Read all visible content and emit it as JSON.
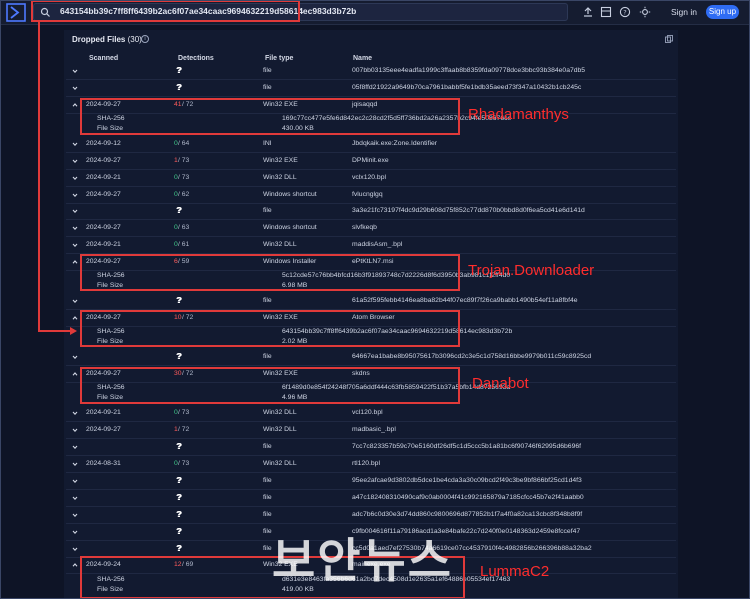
{
  "topbar": {
    "search_value": "643154bb39c7ff8ff6439b2ac6f07ae34caac9694632219d58614ec983d3b72b",
    "signin_label": "Sign in",
    "signup_label": "Sign up",
    "icons": [
      "upload-icon",
      "grid-icon",
      "chat-icon",
      "help-icon",
      "theme-icon"
    ]
  },
  "panel": {
    "title": "Dropped Files",
    "count": "(30)",
    "columns": {
      "scanned": "Scanned",
      "detections": "Detections",
      "file_type": "File type",
      "name": "Name"
    }
  },
  "rows": [
    {
      "scanned": "?",
      "det_num": "",
      "det_total": "?",
      "type": "file",
      "name": "007bb03135eee4eadfa1999c3ffaab8b8359fda09778dce3bbc93b384e0a7db5"
    },
    {
      "scanned": "?",
      "det_num": "",
      "det_total": "?",
      "type": "file",
      "name": "05f8ffd21922a9649b70ca7961babbf5fe1bdb35aeed73f347a10432b1cb245c"
    },
    {
      "scanned": "2024-09-27",
      "det_num": "41",
      "det_total": " / 72",
      "type": "Win32 EXE",
      "name": "jqisaqqd"
    },
    {
      "scanned": "2024-09-12",
      "det_num": "0",
      "det_total": " / 64",
      "type": "INI",
      "name": "Jbdqkaik.exe:Zone.Identifier"
    },
    {
      "scanned": "2024-09-27",
      "det_num": "1",
      "det_total": " / 73",
      "type": "Win32 EXE",
      "name": "DPMinit.exe"
    },
    {
      "scanned": "2024-09-21",
      "det_num": "0",
      "det_total": " / 73",
      "type": "Win32 DLL",
      "name": "vclx120.bpl"
    },
    {
      "scanned": "2024-09-27",
      "det_num": "0",
      "det_total": " / 62",
      "type": "Windows shortcut",
      "name": "fvlucnglgq"
    },
    {
      "scanned": "?",
      "det_num": "",
      "det_total": "?",
      "type": "file",
      "name": "3a3e21fc73197f4dc9d29b608d75f852c77dd870b0bbd8d0f6ea5cd41e6d141d"
    },
    {
      "scanned": "2024-09-27",
      "det_num": "0",
      "det_total": " / 63",
      "type": "Windows shortcut",
      "name": "slvfkeqb"
    },
    {
      "scanned": "2024-09-21",
      "det_num": "0",
      "det_total": " / 61",
      "type": "Win32 DLL",
      "name": "maddisAsm_.bpl"
    },
    {
      "scanned": "2024-09-27",
      "det_num": "6",
      "det_total": " / 59",
      "type": "Windows Installer",
      "name": "ePtKtLN7.msi"
    },
    {
      "scanned": "?",
      "det_num": "",
      "det_total": "?",
      "type": "file",
      "name": "61a52f595febb4146ea8ba82b44f07ec89f7f26ca9babb1490b54ef11a8fbf4e"
    },
    {
      "scanned": "2024-09-27",
      "det_num": "10",
      "det_total": " / 72",
      "type": "Win32 EXE",
      "name": "Atom Browser"
    },
    {
      "scanned": "?",
      "det_num": "",
      "det_total": "?",
      "type": "file",
      "name": "64667ea1babe8b95075617b3096cd2c3e5c1d758d16bbe9979b011c59c8925cd"
    },
    {
      "scanned": "2024-09-27",
      "det_num": "30",
      "det_total": " / 72",
      "type": "Win32 EXE",
      "name": "skdns"
    },
    {
      "scanned": "2024-09-21",
      "det_num": "0",
      "det_total": " / 73",
      "type": "Win32 DLL",
      "name": "vcl120.bpl"
    },
    {
      "scanned": "2024-09-27",
      "det_num": "1",
      "det_total": " / 72",
      "type": "Win32 DLL",
      "name": "madbasic_.bpl"
    },
    {
      "scanned": "?",
      "det_num": "",
      "det_total": "?",
      "type": "file",
      "name": "7cc7c823357b59c70e5160df26df5c1d5ccc5b1a81bc6f90746f62995d6b696f"
    },
    {
      "scanned": "2024-08-31",
      "det_num": "0",
      "det_total": " / 73",
      "type": "Win32 DLL",
      "name": "rtl120.bpl"
    },
    {
      "scanned": "?",
      "det_num": "",
      "det_total": "?",
      "type": "file",
      "name": "95ee2afcae9d3802db5dce1be4cda3a30c09bcd2f49c3be9bf866bf25cd1d4f3"
    },
    {
      "scanned": "?",
      "det_num": "",
      "det_total": "?",
      "type": "file",
      "name": "a47c182408310490caf9c0ab0004f41c992165879a7185cfcc45b7e2f41aabb0"
    },
    {
      "scanned": "?",
      "det_num": "",
      "det_total": "?",
      "type": "file",
      "name": "adc7b6c0d30e3d74dd860c9800696d877852b1f7a4f0a82ca13cbc8f348b8f9f"
    },
    {
      "scanned": "?",
      "det_num": "",
      "det_total": "?",
      "type": "file",
      "name": "c9fb004616f11a79186acd1a3e84bafe22c7d240f0e0148363d2459e8fccef47"
    },
    {
      "scanned": "?",
      "det_num": "",
      "det_total": "?",
      "type": "file",
      "name": "cc5d0a1aed7ef27530b74a6619ce07cc4537910f4c4982856b266396b88a32ba2"
    },
    {
      "scanned": "2024-09-24",
      "det_num": "12",
      "det_total": " / 69",
      "type": "Win32 EXE",
      "name": "mainexe.exe"
    }
  ],
  "expanded": [
    {
      "sha_label": "SHA-256",
      "sha": "169c77cc477e5fe6d842ec2c28cd2f5d5ff736bd2a26a2357b2c94fe508676ce",
      "size_label": "File Size",
      "size": "430.00 KB",
      "annotation": "Rhadamanthys"
    },
    {
      "sha_label": "SHA-256",
      "sha": "5c12cde57c76bb4bfcd16b3f91893748c7d2226d8f6d3950b3ab981c1f2ff4d0",
      "size_label": "File Size",
      "size": "6.98 MB",
      "annotation": "Trojan.Downloader"
    },
    {
      "sha_label": "SHA-256",
      "sha": "643154bb39c7ff8ff6439b2ac6f07ae34caac9694632219d58614ec983d3b72b",
      "size_label": "File Size",
      "size": "2.02 MB",
      "annotation": ""
    },
    {
      "sha_label": "SHA-256",
      "sha": "6f1489d0e854f24248f705a6ddf444c63fb5859422f51b37a5bfb14d8725693a",
      "size_label": "File Size",
      "size": "4.96 MB",
      "annotation": "Danabot"
    },
    {
      "sha_label": "SHA-256",
      "sha": "d631e3e8463fa356b6d61a2bd7dec4508d1e2635a1ef64886e05534ef17463",
      "size_label": "File Size",
      "size": "419.00 KB",
      "annotation": "LummaC2"
    }
  ],
  "watermark": "보안뉴스",
  "colors": {
    "background": "#0e1426",
    "panel": "#121a30",
    "highlight": "#e03a3a",
    "clean": "#3ec98a",
    "malicious": "#ff5b5b",
    "accent": "#2f6cf3"
  }
}
